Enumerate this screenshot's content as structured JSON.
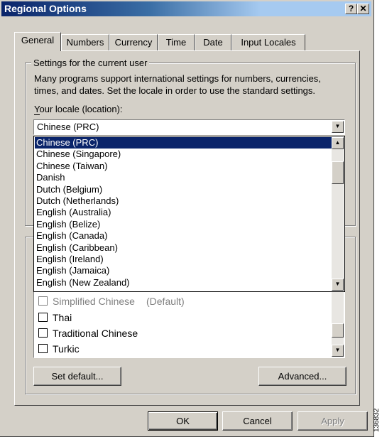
{
  "window": {
    "title": "Regional Options",
    "help_label": "?",
    "close_label": "✕"
  },
  "tabs": [
    "General",
    "Numbers",
    "Currency",
    "Time",
    "Date",
    "Input Locales"
  ],
  "active_tab": "General",
  "settings_group": {
    "label": "Settings for the current user",
    "description_line1": "Many programs support international settings for numbers, currencies,",
    "description_line2": "times, and dates. Set the locale in order to use the standard settings.",
    "locale_label": "Your locale (location):",
    "locale_value": "Chinese (PRC)"
  },
  "locale_dropdown": {
    "items": [
      "Chinese (PRC)",
      "Chinese (Singapore)",
      "Chinese (Taiwan)",
      "Danish",
      "Dutch (Belgium)",
      "Dutch (Netherlands)",
      "English (Australia)",
      "English (Belize)",
      "English (Canada)",
      "English (Caribbean)",
      "English (Ireland)",
      "English (Jamaica)",
      "English (New Zealand)"
    ],
    "selected_index": 0
  },
  "language_list": {
    "items": [
      {
        "label": "Simplified Chinese",
        "suffix": "(Default)",
        "checked": false,
        "disabled": true
      },
      {
        "label": "Thai",
        "checked": false,
        "disabled": false
      },
      {
        "label": "Traditional Chinese",
        "checked": false,
        "disabled": false
      },
      {
        "label": "Turkic",
        "checked": false,
        "disabled": false
      }
    ]
  },
  "buttons": {
    "set_default": "Set default...",
    "advanced": "Advanced...",
    "ok": "OK",
    "cancel": "Cancel",
    "apply": "Apply"
  },
  "figure_id": "136832"
}
